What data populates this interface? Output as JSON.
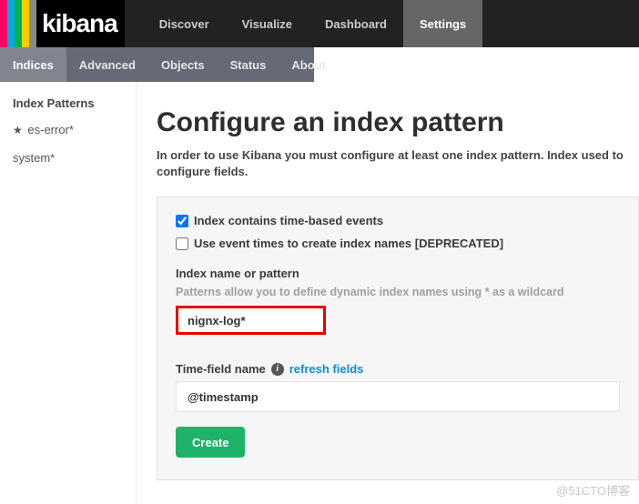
{
  "logo": {
    "text": "kibana",
    "stripes": [
      "#ff0066",
      "#00a9e0",
      "#00b04f",
      "#ffcc00",
      "#888888"
    ]
  },
  "topnav": {
    "items": [
      {
        "label": "Discover"
      },
      {
        "label": "Visualize"
      },
      {
        "label": "Dashboard"
      },
      {
        "label": "Settings",
        "active": true
      }
    ]
  },
  "subtabs": {
    "items": [
      {
        "label": "Indices",
        "active": true
      },
      {
        "label": "Advanced"
      },
      {
        "label": "Objects"
      },
      {
        "label": "Status"
      },
      {
        "label": "About"
      }
    ]
  },
  "sidebar": {
    "heading": "Index Patterns",
    "items": [
      {
        "label": "es-error*",
        "star": true
      },
      {
        "label": "system*"
      }
    ]
  },
  "main": {
    "title": "Configure an index pattern",
    "lead": "In order to use Kibana you must configure at least one index pattern. Index used to configure fields.",
    "checkbox_time": {
      "label": "Index contains time-based events",
      "checked": true
    },
    "checkbox_eventtimes": {
      "label": "Use event times to create index names [DEPRECATED]",
      "checked": false
    },
    "index_name_label": "Index name or pattern",
    "index_name_hint": "Patterns allow you to define dynamic index names using * as a wildcard",
    "index_name_value": "nignx-log*",
    "timefield_label": "Time-field name",
    "refresh_link": "refresh fields",
    "timefield_value": "@timestamp",
    "create_button": "Create"
  },
  "watermark": "@51CTO博客"
}
